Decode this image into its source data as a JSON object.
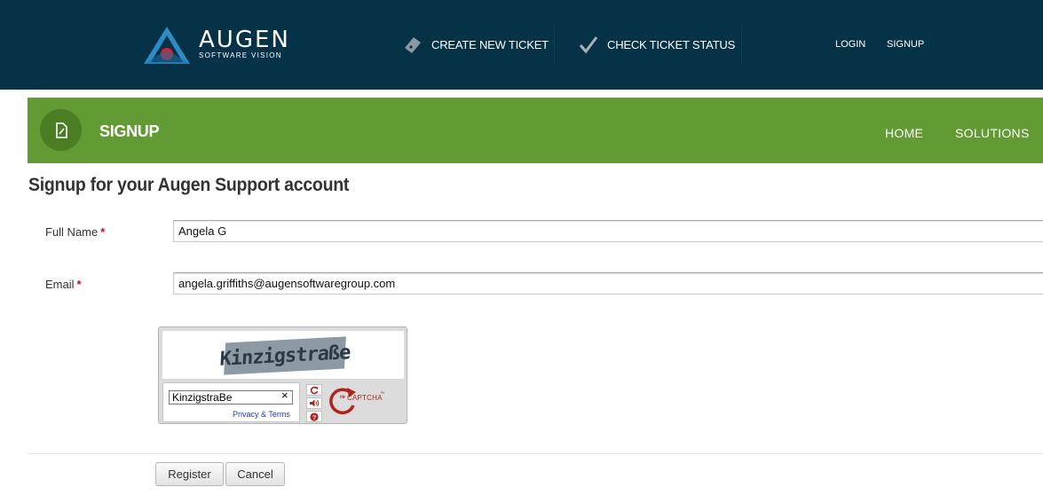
{
  "header": {
    "logo_name": "AUGEN",
    "logo_tagline": "SOFTWARE VISION",
    "nav": {
      "create_ticket": "CREATE NEW TICKET",
      "check_status": "CHECK TICKET STATUS"
    },
    "links": {
      "login": "LOGIN",
      "signup": "SIGNUP"
    }
  },
  "banner": {
    "title": "SIGNUP",
    "links": {
      "home": "HOME",
      "solutions": "SOLUTIONS"
    }
  },
  "page": {
    "title": "Signup for your Augen Support account"
  },
  "form": {
    "required_mark": "*",
    "full_name": {
      "label": "Full Name",
      "value": "Angela G"
    },
    "email": {
      "label": "Email",
      "value": "angela.griffiths@augensoftwaregroup.com"
    },
    "captcha": {
      "challenge_word": "Kinzigstraße",
      "response_value": "KinzigstraBe",
      "clear_symbol": "×",
      "privacy_link": "Privacy & Terms",
      "logo_prefix": "re",
      "logo_text": "CAPTCHA",
      "logo_tm": "™"
    },
    "buttons": {
      "register": "Register",
      "cancel": "Cancel"
    }
  },
  "colors": {
    "header_bg": "#063248",
    "banner_bg": "#629a34",
    "banner_icon_bg": "#4a7d24",
    "required": "#c0151b",
    "captcha_red": "#b0241e"
  },
  "icons": {
    "logo": "augen-logo-icon",
    "ticket": "ticket-icon",
    "check": "checkmark-icon",
    "banner": "edit-document-icon",
    "captcha_reload": "reload-icon",
    "captcha_audio": "audio-icon",
    "captcha_help": "help-icon"
  }
}
